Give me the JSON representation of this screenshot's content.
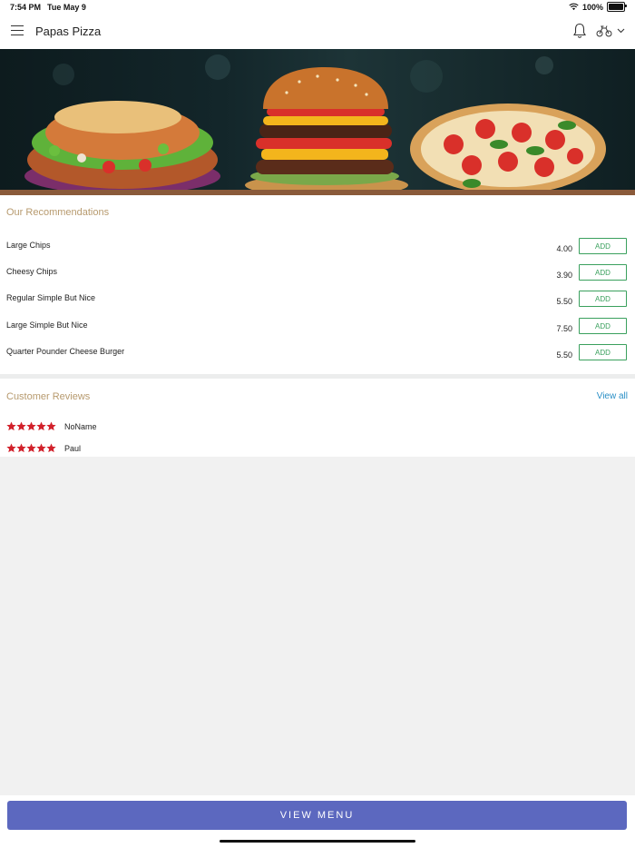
{
  "status_bar": {
    "time": "7:54 PM",
    "date": "Tue May 9",
    "battery": "100%",
    "icons": [
      "wifi-icon",
      "battery-icon"
    ]
  },
  "header": {
    "title": "Papas Pizza",
    "icons": [
      "menu-icon",
      "bell-icon",
      "delivery-bike-icon",
      "chevron-down-icon"
    ]
  },
  "hero": {
    "image": "food-banner: kebab sandwich, cheeseburger, pizza"
  },
  "recommendations": {
    "title": "Our Recommendations",
    "add_label": "ADD",
    "items": [
      {
        "name": "Large Chips",
        "price": "4.00"
      },
      {
        "name": "Cheesy Chips",
        "price": "3.90"
      },
      {
        "name": "Regular Simple But Nice",
        "price": "5.50"
      },
      {
        "name": "Large Simple But Nice",
        "price": "7.50"
      },
      {
        "name": "Quarter Pounder Cheese Burger",
        "price": "5.50"
      }
    ]
  },
  "reviews": {
    "title": "Customer Reviews",
    "view_all": "View all",
    "items": [
      {
        "name": "NoName",
        "rating": 5
      },
      {
        "name": "Paul",
        "rating": 5
      }
    ]
  },
  "footer": {
    "view_menu_label": "VIEW MENU"
  },
  "colors": {
    "accent_gold": "#b79a6e",
    "add_green": "#3aa05d",
    "link_blue": "#2a8fc6",
    "button_indigo": "#5c68bf",
    "star_red": "#d2212b"
  }
}
